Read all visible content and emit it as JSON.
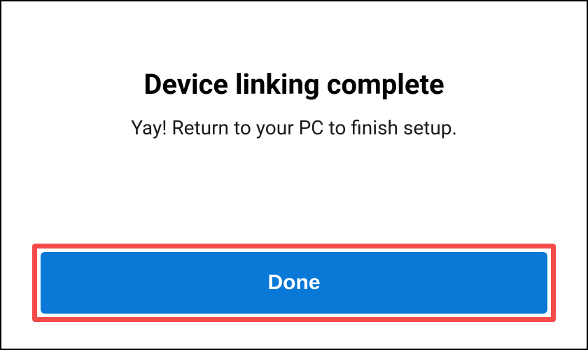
{
  "dialog": {
    "title": "Device linking complete",
    "subtitle": "Yay! Return to your PC to finish setup.",
    "button_label": "Done"
  },
  "colors": {
    "highlight_border": "#f44a4a",
    "button_bg": "#0a78d6",
    "button_text": "#ffffff"
  }
}
